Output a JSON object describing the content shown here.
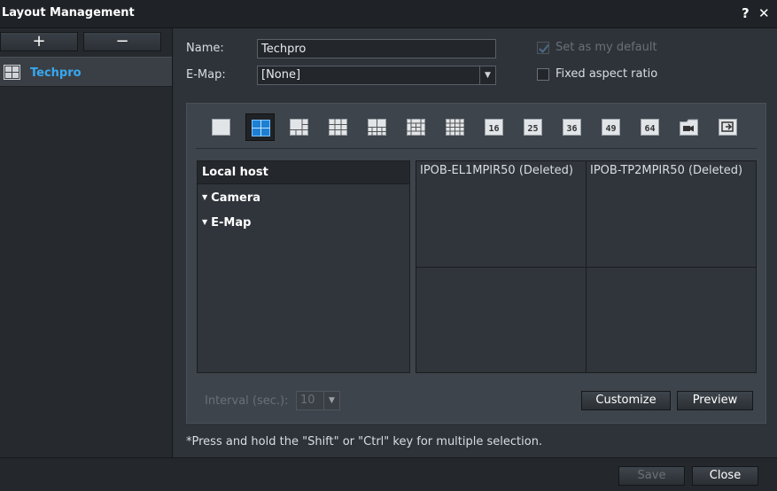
{
  "window": {
    "title": "Layout Management",
    "help_glyph": "?",
    "close_glyph": "✕"
  },
  "sidebar": {
    "add_label": "+",
    "remove_label": "−",
    "items": [
      {
        "label": "Techpro"
      }
    ]
  },
  "form": {
    "name_label": "Name:",
    "name_value": "Techpro",
    "emap_label": "E-Map:",
    "emap_value": "[None]",
    "default_label": "Set as my default",
    "default_checked": true,
    "aspect_label": "Fixed aspect ratio",
    "aspect_checked": false
  },
  "layouts": [
    {
      "name": "layout-1",
      "text": ""
    },
    {
      "name": "layout-4",
      "text": ""
    },
    {
      "name": "layout-6",
      "text": ""
    },
    {
      "name": "layout-9",
      "text": ""
    },
    {
      "name": "layout-10",
      "text": ""
    },
    {
      "name": "layout-13",
      "text": ""
    },
    {
      "name": "layout-16a",
      "text": ""
    },
    {
      "name": "layout-16",
      "text": "16"
    },
    {
      "name": "layout-25",
      "text": "25"
    },
    {
      "name": "layout-36",
      "text": "36"
    },
    {
      "name": "layout-49",
      "text": "49"
    },
    {
      "name": "layout-64",
      "text": "64"
    },
    {
      "name": "camera-folder",
      "text": ""
    },
    {
      "name": "custom-layout",
      "text": ""
    }
  ],
  "tree": {
    "header": "Local host",
    "nodes": [
      {
        "label": "Camera"
      },
      {
        "label": "E-Map"
      }
    ]
  },
  "grid_cells": [
    "IPOB-EL1MPIR50 (Deleted)",
    "IPOB-TP2MPIR50 (Deleted)",
    "",
    ""
  ],
  "interval": {
    "label": "Interval (sec.):",
    "value": "10"
  },
  "buttons": {
    "customize": "Customize",
    "preview": "Preview",
    "save": "Save",
    "close": "Close"
  },
  "hint": "*Press and hold the \"Shift\" or \"Ctrl\" key for multiple selection.",
  "colors": {
    "accent": "#38a8f0",
    "selected_layout": "#1e7fd0"
  }
}
